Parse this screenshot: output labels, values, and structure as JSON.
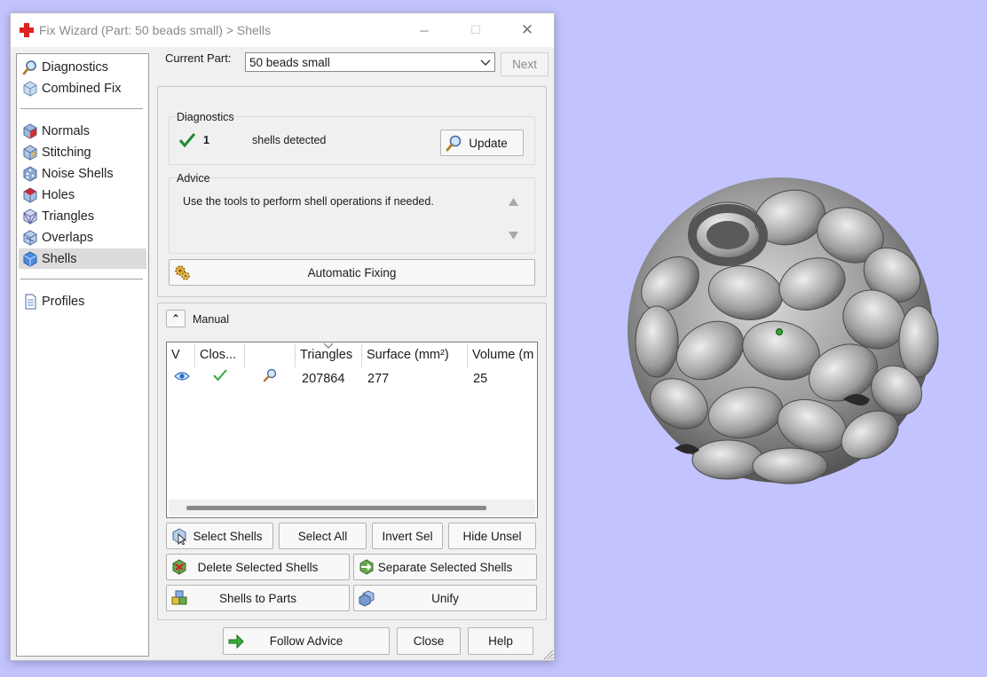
{
  "window": {
    "title": "Fix Wizard (Part: 50 beads small) > Shells",
    "minimize_label": "─",
    "maximize_label": "☐",
    "close_label": "✕"
  },
  "sidebar": {
    "groups": [
      [
        {
          "label": "Diagnostics",
          "icon": "magnifier-icon"
        },
        {
          "label": "Combined Fix",
          "icon": "cube-icon"
        }
      ],
      [
        {
          "label": "Normals",
          "icon": "normals-cube-icon"
        },
        {
          "label": "Stitching",
          "icon": "stitching-cube-icon"
        },
        {
          "label": "Noise Shells",
          "icon": "noise-cube-icon"
        },
        {
          "label": "Holes",
          "icon": "holes-cube-icon"
        },
        {
          "label": "Triangles",
          "icon": "triangles-cube-icon"
        },
        {
          "label": "Overlaps",
          "icon": "overlaps-cube-icon"
        },
        {
          "label": "Shells",
          "icon": "shells-cube-icon",
          "selected": true
        }
      ],
      [
        {
          "label": "Profiles",
          "icon": "document-icon"
        }
      ]
    ]
  },
  "current_part": {
    "label": "Current Part:",
    "value": "50 beads small",
    "next_label": "Next"
  },
  "diagnostics": {
    "label": "Diagnostics",
    "count": "1",
    "status_text": "shells detected",
    "update_label": "Update"
  },
  "advice": {
    "label": "Advice",
    "text": "Use the tools to perform shell operations if needed."
  },
  "automatic_fixing_label": "Automatic Fixing",
  "manual": {
    "label": "Manual",
    "collapse_glyph": "⌃"
  },
  "table": {
    "columns": [
      "V",
      "Clos...",
      "",
      "Triangles",
      "Surface (mm²)",
      "Volume (m"
    ],
    "rows": [
      {
        "triangles": "207864",
        "surface": "277",
        "volume": "25"
      }
    ]
  },
  "buttons": {
    "select_shells": "Select Shells",
    "select_all": "Select All",
    "invert_sel": "Invert Sel",
    "hide_unsel": "Hide Unsel",
    "delete_selected": "Delete Selected Shells",
    "separate_selected": "Separate Selected Shells",
    "shells_to_parts": "Shells to Parts",
    "unify": "Unify",
    "follow_advice": "Follow Advice",
    "close": "Close",
    "help": "Help"
  },
  "colors": {
    "background": "#c3c3ff",
    "check_green": "#2e9e3e",
    "selected_row": "#dcdcdc"
  }
}
